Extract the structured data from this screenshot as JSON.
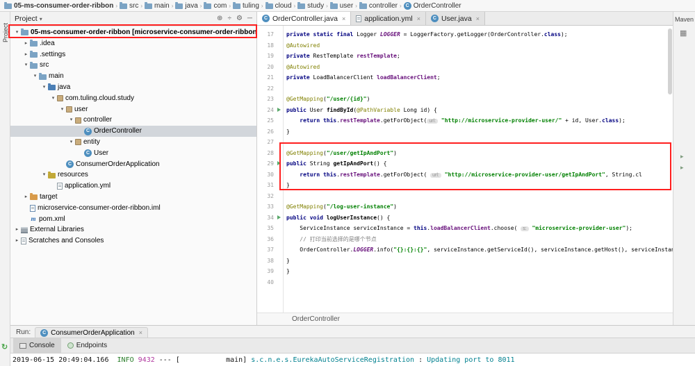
{
  "colors": {
    "annotation_red": "#FF1F1F",
    "keyword_blue": "#000080",
    "string_green": "#008000",
    "annotation_olive": "#808000",
    "field_purple": "#660E7A",
    "run_green": "#59A869",
    "selection_gray": "#D2D6DB",
    "logger_cyan": "#00808F",
    "pid_magenta": "#B0399F"
  },
  "nav_bar": {
    "separator": "›",
    "items": [
      {
        "label": "05-ms-consumer-order-ribbon",
        "icon": "folder-icon"
      },
      {
        "label": "src",
        "icon": "folder-icon"
      },
      {
        "label": "main",
        "icon": "folder-icon"
      },
      {
        "label": "java",
        "icon": "folder-icon"
      },
      {
        "label": "com",
        "icon": "folder-icon"
      },
      {
        "label": "tuling",
        "icon": "folder-icon"
      },
      {
        "label": "cloud",
        "icon": "folder-icon"
      },
      {
        "label": "study",
        "icon": "folder-icon"
      },
      {
        "label": "user",
        "icon": "folder-icon"
      },
      {
        "label": "controller",
        "icon": "folder-icon"
      },
      {
        "label": "OrderController",
        "icon": "class-icon"
      }
    ]
  },
  "left_bar": {
    "project_tool_tab": "Project"
  },
  "project_panel": {
    "header": {
      "title": "Project",
      "caret": "▾",
      "icons": [
        {
          "name": "locate-icon",
          "glyph": "⊕"
        },
        {
          "name": "collapse-all-icon",
          "glyph": "÷"
        },
        {
          "name": "settings-gear-icon",
          "glyph": "⚙"
        },
        {
          "name": "hide-icon",
          "glyph": "─"
        }
      ]
    },
    "arrow_expanded": "▾",
    "arrow_collapsed": "▸",
    "tree": [
      {
        "label": "05-ms-consumer-order-ribbon [microservice-consumer-order-ribbon]",
        "level": 0,
        "arrow": "expanded",
        "icon": "folder-icon",
        "bold": true
      },
      {
        "label": ".idea",
        "level": 1,
        "arrow": "collapsed",
        "icon": "folder-icon"
      },
      {
        "label": ".settings",
        "level": 1,
        "arrow": "collapsed",
        "icon": "folder-icon"
      },
      {
        "label": "src",
        "level": 1,
        "arrow": "expanded",
        "icon": "folder-icon"
      },
      {
        "label": "main",
        "level": 2,
        "arrow": "expanded",
        "icon": "folder-icon"
      },
      {
        "label": "java",
        "level": 3,
        "arrow": "expanded",
        "icon": "source-folder-icon"
      },
      {
        "label": "com.tuling.cloud.study",
        "level": 4,
        "arrow": "expanded",
        "icon": "package-icon"
      },
      {
        "label": "user",
        "level": 5,
        "arrow": "expanded",
        "icon": "package-icon"
      },
      {
        "label": "controller",
        "level": 6,
        "arrow": "expanded",
        "icon": "package-icon"
      },
      {
        "label": "OrderController",
        "level": 7,
        "arrow": "none",
        "icon": "class-icon",
        "selected": true
      },
      {
        "label": "entity",
        "level": 6,
        "arrow": "expanded",
        "icon": "package-icon"
      },
      {
        "label": "User",
        "level": 7,
        "arrow": "none",
        "icon": "class-icon"
      },
      {
        "label": "ConsumerOrderApplication",
        "level": 5,
        "arrow": "none",
        "icon": "class-icon"
      },
      {
        "label": "resources",
        "level": 3,
        "arrow": "expanded",
        "icon": "resources-folder-icon"
      },
      {
        "label": "application.yml",
        "level": 4,
        "arrow": "none",
        "icon": "yml-file-icon"
      },
      {
        "label": "target",
        "level": 1,
        "arrow": "collapsed",
        "icon": "excluded-folder-icon"
      },
      {
        "label": "microservice-consumer-order-ribbon.iml",
        "level": 1,
        "arrow": "none",
        "icon": "iml-file-icon"
      },
      {
        "label": "pom.xml",
        "level": 1,
        "arrow": "none",
        "icon": "maven-file-icon"
      },
      {
        "label": "External Libraries",
        "level": 0,
        "arrow": "collapsed",
        "icon": "library-icon"
      },
      {
        "label": "Scratches and Consoles",
        "level": 0,
        "arrow": "collapsed",
        "icon": "scratch-icon"
      }
    ]
  },
  "editor": {
    "close_glyph": "×",
    "tabs": [
      {
        "label": "OrderController.java",
        "icon": "class-icon",
        "active": true
      },
      {
        "label": "application.yml",
        "icon": "yml-file-icon",
        "active": false
      },
      {
        "label": "User.java",
        "icon": "class-icon",
        "active": false
      }
    ],
    "first_line": 17,
    "last_line": 40,
    "run_gutter_lines": [
      24,
      29,
      34
    ],
    "breadcrumb": "OrderController",
    "code_lines": [
      {
        "line": 17,
        "segs": [
          [
            "k",
            "private static final "
          ],
          [
            "p",
            "Logger "
          ],
          [
            "sf",
            "LOGGER"
          ],
          [
            "p",
            " = LoggerFactory.getLogger(OrderController."
          ],
          [
            "k",
            "class"
          ],
          [
            "p",
            ");"
          ]
        ]
      },
      {
        "line": 18,
        "segs": [
          [
            "a",
            "@Autowired"
          ]
        ]
      },
      {
        "line": 19,
        "segs": [
          [
            "k",
            "private "
          ],
          [
            "p",
            "RestTemplate "
          ],
          [
            "f",
            "restTemplate"
          ],
          [
            "p",
            ";"
          ]
        ]
      },
      {
        "line": 20,
        "segs": [
          [
            "a",
            "@Autowired"
          ]
        ]
      },
      {
        "line": 21,
        "segs": [
          [
            "k",
            "private "
          ],
          [
            "p",
            "LoadBalancerClient "
          ],
          [
            "f",
            "loadBalancerClient"
          ],
          [
            "p",
            ";"
          ]
        ]
      },
      {
        "line": 22,
        "segs": []
      },
      {
        "line": 23,
        "segs": [
          [
            "a",
            "@GetMapping"
          ],
          [
            "p",
            "("
          ],
          [
            "s",
            "\"/user/{id}\""
          ],
          [
            "p",
            ")"
          ]
        ]
      },
      {
        "line": 24,
        "segs": [
          [
            "k",
            "public "
          ],
          [
            "p",
            "User "
          ],
          [
            "m",
            "findById"
          ],
          [
            "p",
            "("
          ],
          [
            "a",
            "@PathVariable"
          ],
          [
            "p",
            " Long id) {"
          ]
        ]
      },
      {
        "line": 25,
        "segs": [
          [
            "p",
            "    "
          ],
          [
            "k",
            "return this"
          ],
          [
            "p",
            "."
          ],
          [
            "f",
            "restTemplate"
          ],
          [
            "p",
            ".getForObject("
          ],
          [
            "h",
            "url:"
          ],
          [
            "p",
            " "
          ],
          [
            "s",
            "\"http://microservice-provider-user/\""
          ],
          [
            "p",
            " + id, User."
          ],
          [
            "k",
            "class"
          ],
          [
            "p",
            ");"
          ]
        ]
      },
      {
        "line": 26,
        "segs": [
          [
            "p",
            "}"
          ]
        ]
      },
      {
        "line": 27,
        "segs": []
      },
      {
        "line": 28,
        "segs": [
          [
            "a",
            "@GetMapping"
          ],
          [
            "p",
            "("
          ],
          [
            "s",
            "\"/user/getIpAndPort\""
          ],
          [
            "p",
            ")"
          ]
        ]
      },
      {
        "line": 29,
        "segs": [
          [
            "k",
            "public "
          ],
          [
            "p",
            "String "
          ],
          [
            "m",
            "getIpAndPort"
          ],
          [
            "p",
            "() {"
          ]
        ]
      },
      {
        "line": 30,
        "segs": [
          [
            "p",
            "    "
          ],
          [
            "k",
            "return this"
          ],
          [
            "p",
            "."
          ],
          [
            "f",
            "restTemplate"
          ],
          [
            "p",
            ".getForObject( "
          ],
          [
            "h",
            "url:"
          ],
          [
            "p",
            " "
          ],
          [
            "s",
            "\"http://microservice-provider-user/getIpAndPort\""
          ],
          [
            "p",
            ", String.cl"
          ]
        ]
      },
      {
        "line": 31,
        "segs": [
          [
            "p",
            "}"
          ]
        ]
      },
      {
        "line": 32,
        "segs": []
      },
      {
        "line": 33,
        "segs": [
          [
            "a",
            "@GetMapping"
          ],
          [
            "p",
            "("
          ],
          [
            "s",
            "\"/log-user-instance\""
          ],
          [
            "p",
            ")"
          ]
        ]
      },
      {
        "line": 34,
        "segs": [
          [
            "k",
            "public void "
          ],
          [
            "m",
            "logUserInstance"
          ],
          [
            "p",
            "() {"
          ]
        ]
      },
      {
        "line": 35,
        "segs": [
          [
            "p",
            "    ServiceInstance serviceInstance = "
          ],
          [
            "k",
            "this"
          ],
          [
            "p",
            "."
          ],
          [
            "f",
            "loadBalancerClient"
          ],
          [
            "p",
            ".choose( "
          ],
          [
            "h",
            "s:"
          ],
          [
            "p",
            " "
          ],
          [
            "s",
            "\"microservice-provider-user\""
          ],
          [
            "p",
            ");"
          ]
        ]
      },
      {
        "line": 36,
        "segs": [
          [
            "p",
            "    "
          ],
          [
            "c",
            "// 打印当前选择的是哪个节点"
          ]
        ]
      },
      {
        "line": 37,
        "segs": [
          [
            "p",
            "    OrderController."
          ],
          [
            "sf",
            "LOGGER"
          ],
          [
            "p",
            ".info("
          ],
          [
            "s",
            "\"{}:{}:{}\""
          ],
          [
            "p",
            ", serviceInstance.getServiceId(), serviceInstance.getHost(), serviceInstance"
          ]
        ]
      },
      {
        "line": 38,
        "segs": [
          [
            "p",
            "}"
          ]
        ]
      },
      {
        "line": 39,
        "segs": [
          [
            "p",
            "}"
          ]
        ]
      },
      {
        "line": 40,
        "segs": []
      }
    ]
  },
  "right_bar": {
    "maven_label": "Maven",
    "icons": [
      {
        "name": "grid-icon",
        "glyph": "▦"
      }
    ],
    "chevrons": [
      {
        "name": "chevron-right-icon",
        "glyph": "▸"
      },
      {
        "name": "chevron-right-icon",
        "glyph": "▸"
      }
    ]
  },
  "run_panel": {
    "run_label": "Run:",
    "config_tab": {
      "label": "ConsumerOrderApplication",
      "icon": "class-icon"
    },
    "tabs": [
      {
        "label": "Console",
        "icon": "console-icon",
        "active": true
      },
      {
        "label": "Endpoints",
        "icon": "endpoint-icon",
        "active": false
      }
    ],
    "console_line": [
      [
        "plain",
        "2019-06-15 20:49:04.166"
      ],
      [
        "plain",
        "  "
      ],
      [
        "level",
        "INFO"
      ],
      [
        "plain",
        " "
      ],
      [
        "pid",
        "9432"
      ],
      [
        "plain",
        " --- [           main] "
      ],
      [
        "logger",
        "s.c.n.e.s.EurekaAutoServiceRegistration"
      ],
      [
        "plain",
        " : "
      ],
      [
        "message",
        "Updating port to 8011"
      ]
    ]
  }
}
